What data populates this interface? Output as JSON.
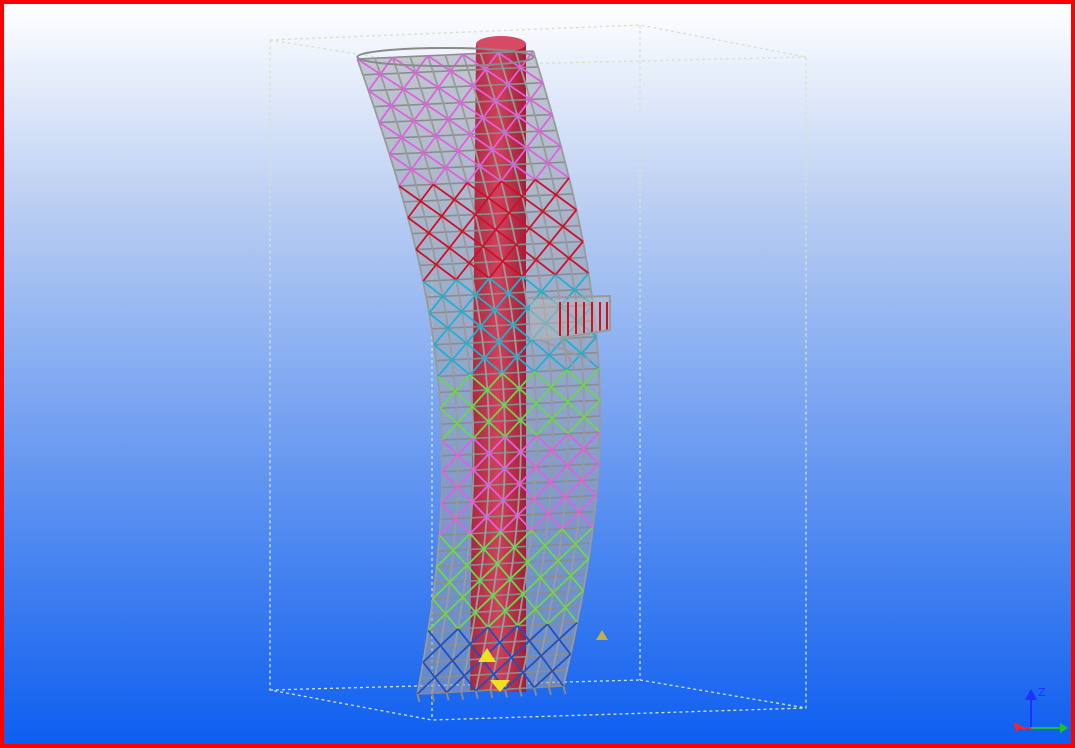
{
  "viewport": {
    "border_color": "#ff0000",
    "background_top": "#ffffff",
    "background_bottom": "#0d5ef0",
    "active": true
  },
  "model": {
    "structure": "curved-tower-frame",
    "core_color": "#c7334f",
    "bounding_box_color": "#c8dcc0",
    "member_colors": [
      "#d0102a",
      "#e060e0",
      "#22b0d0",
      "#6ad84a",
      "#8a8a8a",
      "#bf2a2a",
      "#f0e020",
      "#2050c0"
    ]
  },
  "axis_triad": {
    "z_label": "Z",
    "x_color": "#ff2020",
    "y_color": "#20c020",
    "z_color": "#2030ff"
  }
}
